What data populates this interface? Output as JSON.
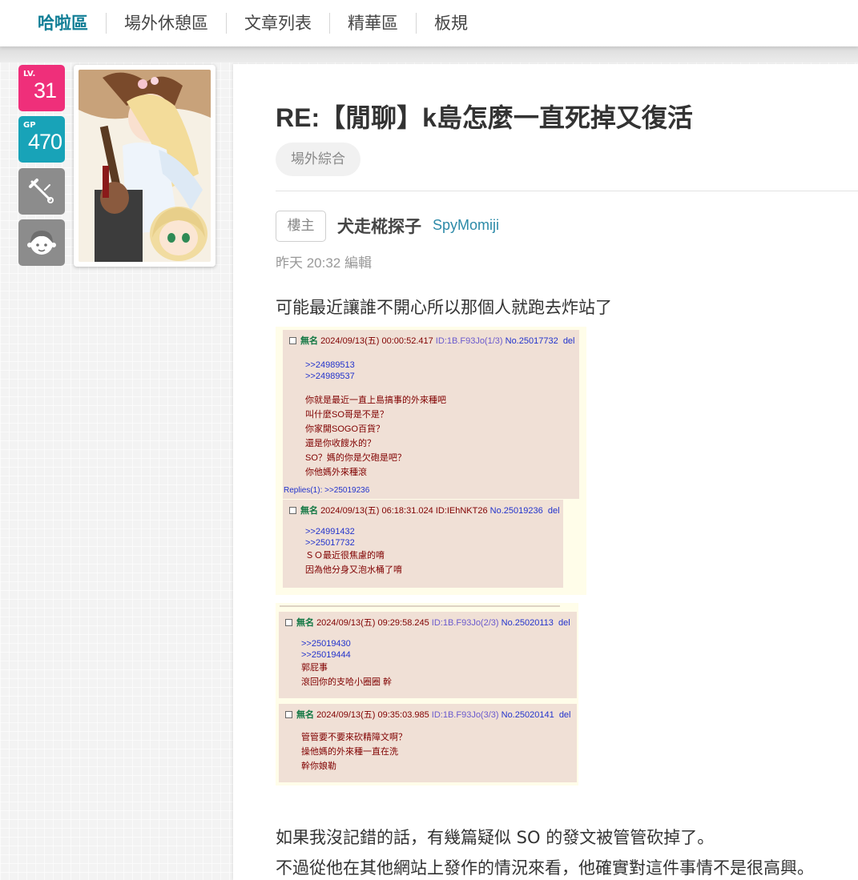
{
  "nav": {
    "items": [
      "哈啦區",
      "場外休憩區",
      "文章列表",
      "精華區",
      "板規"
    ],
    "active_index": 0
  },
  "user_badges": {
    "lv_label": "LV.",
    "lv_value": "31",
    "gp_label": "GP",
    "gp_value": "470"
  },
  "post": {
    "title": "RE:【閒聊】k島怎麼一直死掉又復活",
    "board_tag": "場外綜合",
    "owner_tag": "樓主",
    "author_name": "犬走椛探子",
    "author_id": "SpyMomiji",
    "timestamp": "昨天 20:32 編輯",
    "para1": "可能最近讓誰不開心所以那個人就跑去炸站了",
    "para2": "如果我沒記錯的話，有幾篇疑似 SO 的發文被管管砍掉了。",
    "para3": "不過從他在其他網站上發作的情況來看，他確實對這件事情不是很高興。"
  },
  "embedded_thread": {
    "replies": [
      {
        "name": "無名",
        "datetime": "2024/09/13(五) 00:00:52.417",
        "id": "ID:1B.F93Jo(1/3)",
        "no": "No.25017732",
        "del": "del",
        "quotes": [
          ">>24989513",
          ">>24989537"
        ],
        "lines": [
          "你就是最近一直上島搞事的外來種吧",
          "叫什麼SO哥是不是？",
          "你家開SOGO百貨？",
          "還是你收餿水的？",
          "SO？媽的你是欠砲是吧？",
          "你他媽外來種滾"
        ],
        "replies_line": "Replies(1):  >>25019236"
      },
      {
        "name": "無名",
        "datetime": "2024/09/13(五) 06:18:31.024",
        "id": "ID:IEhNKT26",
        "no": "No.25019236",
        "del": "del",
        "quotes": [
          ">>24991432",
          ">>25017732"
        ],
        "lines": [
          "ＳＯ最近很焦慮的唷",
          "因為他分身又泡水桶了唷"
        ]
      },
      {
        "name": "無名",
        "datetime": "2024/09/13(五) 09:29:58.245",
        "id": "ID:1B.F93Jo(2/3)",
        "no": "No.25020113",
        "del": "del",
        "quotes": [
          ">>25019430",
          ">>25019444"
        ],
        "lines": [
          "郭屁事",
          "滾回你的支哈小圈圈 幹"
        ]
      },
      {
        "name": "無名",
        "datetime": "2024/09/13(五) 09:35:03.985",
        "id": "ID:1B.F93Jo(3/3)",
        "no": "No.25020141",
        "del": "del",
        "quotes": [],
        "lines": [
          "管管要不要來砍精障文啊？",
          "操他媽的外來種一直在洗",
          "幹你娘勒"
        ]
      }
    ]
  }
}
